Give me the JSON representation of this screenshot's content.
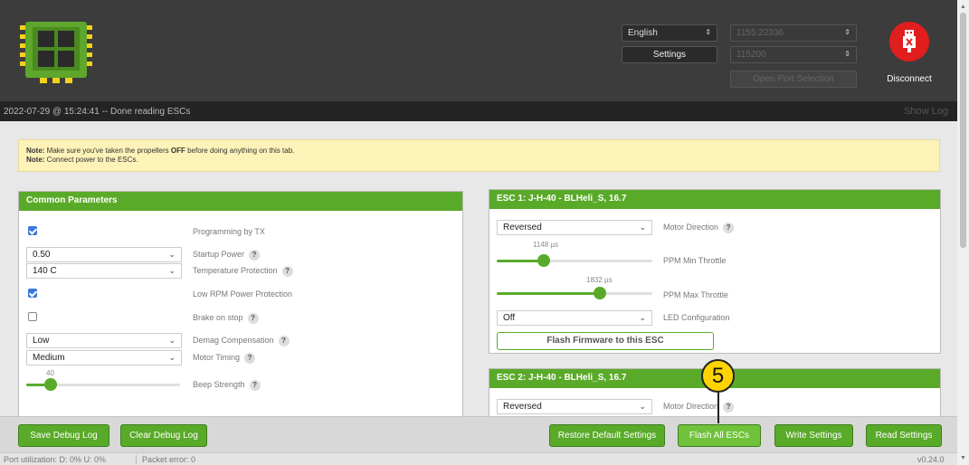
{
  "header": {
    "language": "English",
    "settings_label": "Settings",
    "port": "1155:22336",
    "baud": "115200",
    "open_port_label": "Open Port Selection",
    "disconnect_label": "Disconnect"
  },
  "log": {
    "text": "2022-07-29 @ 15:24:41 -- Done reading ESCs",
    "show_log_label": "Show Log"
  },
  "note": {
    "line1_bold": "Note:",
    "line1_a": " Make sure you've taken the propellers ",
    "line1_off": "OFF",
    "line1_b": " before doing anything on this tab.",
    "line2_bold": "Note:",
    "line2": " Connect power to the ESCs."
  },
  "common": {
    "title": "Common Parameters",
    "programming_by_tx": "Programming by TX",
    "startup_power_value": "0.50",
    "startup_power_label": "Startup Power",
    "temp_protection_value": "140 C",
    "temp_protection_label": "Temperature Protection",
    "low_rpm_label": "Low RPM Power Protection",
    "brake_label": "Brake on stop",
    "demag_value": "Low",
    "demag_label": "Demag Compensation",
    "timing_value": "Medium",
    "timing_label": "Motor Timing",
    "beep_value": "40",
    "beep_label": "Beep Strength",
    "beep_fraction": 0.16
  },
  "esc1": {
    "title": "ESC 1: J-H-40 - BLHeli_S, 16.7",
    "direction_value": "Reversed",
    "direction_label": "Motor Direction",
    "min_throttle_value": "1148 µs",
    "min_throttle_label": "PPM Min Throttle",
    "min_fraction": 0.3,
    "max_throttle_value": "1832 µs",
    "max_throttle_label": "PPM Max Throttle",
    "max_fraction": 0.66,
    "led_value": "Off",
    "led_label": "LED Configuration",
    "flash_label": "Flash Firmware to this ESC"
  },
  "esc2": {
    "title": "ESC 2: J-H-40 - BLHeli_S, 16.7",
    "direction_value": "Reversed",
    "direction_label": "Motor Direction"
  },
  "help_glyph": "?",
  "footer": {
    "save_debug": "Save Debug Log",
    "clear_debug": "Clear Debug Log",
    "restore": "Restore Default Settings",
    "flash_all": "Flash All ESCs",
    "write": "Write Settings",
    "read": "Read Settings"
  },
  "status": {
    "port_util": "Port utilization: D: 0% U: 0%",
    "packet_error": "Packet error: 0",
    "version": "v0.24.0"
  },
  "marker": "5",
  "colors": {
    "accent": "#59aa29",
    "note_bg": "#fdf2b8",
    "disconnect": "#e01e1e",
    "marker": "#ffd400"
  }
}
